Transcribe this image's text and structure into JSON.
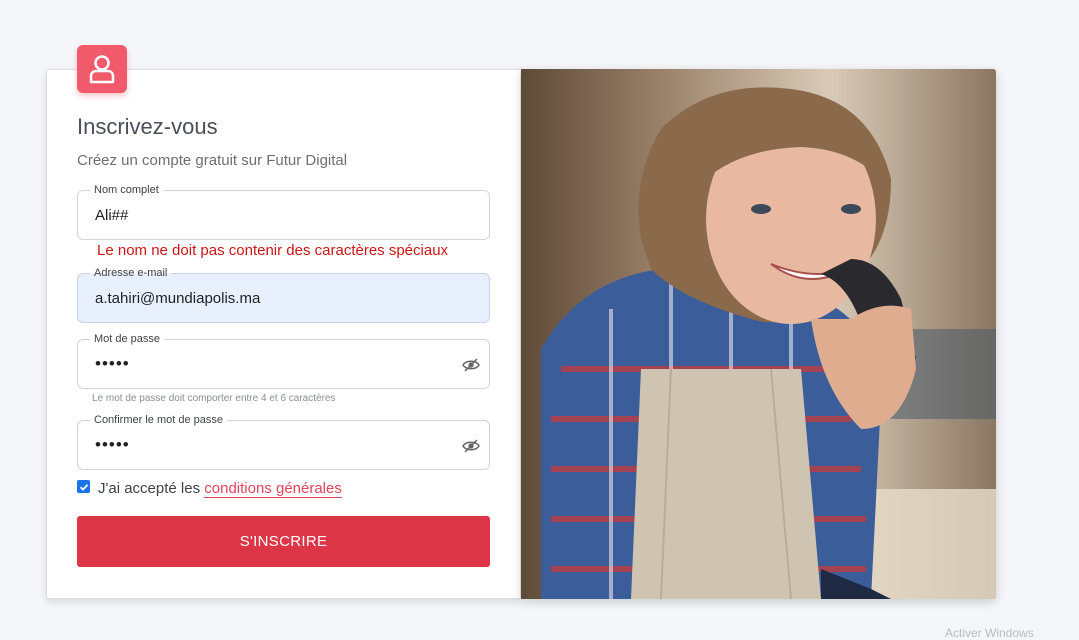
{
  "form": {
    "title": "Inscrivez-vous",
    "subtitle": "Créez un compte gratuit sur Futur Digital",
    "full_name": {
      "label": "Nom complet",
      "value": "Ali##",
      "error": "Le nom ne doit pas contenir des caractères spéciaux"
    },
    "email": {
      "label": "Adresse e-mail",
      "value": "a.tahiri@mundiapolis.ma"
    },
    "password": {
      "label": "Mot de passe",
      "masked": "•••••",
      "hint": "Le mot de passe doit comporter entre 4 et 6 caractères"
    },
    "confirm_password": {
      "label": "Confirmer le mot de passe",
      "masked": "•••••"
    },
    "terms": {
      "prefix": "J'ai accepté les ",
      "link": "conditions générales",
      "checked": true
    },
    "submit_label": "S'INSCRIRE"
  },
  "icons": {
    "avatar": "user-icon",
    "password_toggle": "eye-slash-icon"
  },
  "colors": {
    "accent": "#dc3545",
    "avatar_bg": "#f05a6a",
    "error": "#cc1515",
    "autofill_bg": "#e8f0fe"
  },
  "photo": {
    "subject": "woman-on-phone-illustration"
  },
  "watermark": "Activer Windows"
}
